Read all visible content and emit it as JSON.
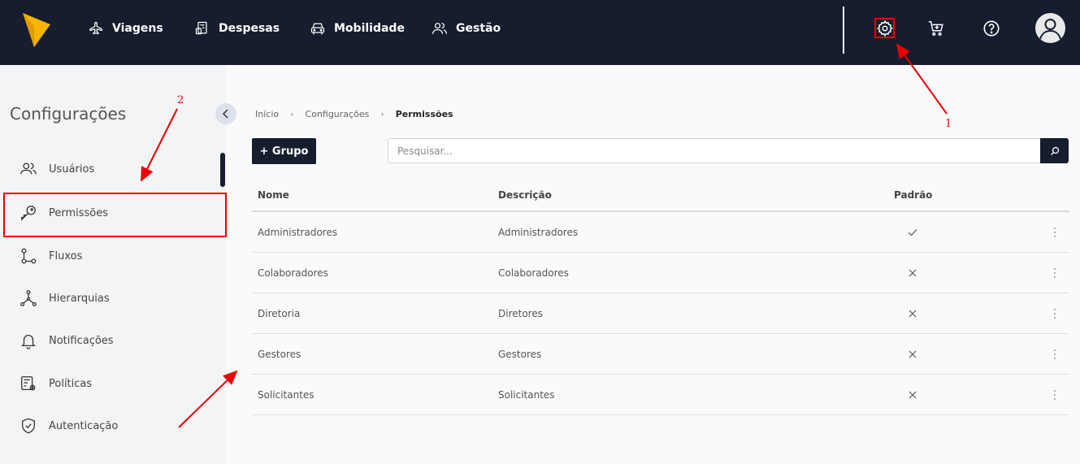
{
  "topbar": {
    "nav": [
      {
        "label": "Viagens",
        "icon": "airplane-icon"
      },
      {
        "label": "Despesas",
        "icon": "receipt-icon"
      },
      {
        "label": "Mobilidade",
        "icon": "car-icon"
      },
      {
        "label": "Gestão",
        "icon": "users-icon"
      }
    ],
    "icons": [
      "gear-icon",
      "cart-icon",
      "help-icon",
      "avatar"
    ]
  },
  "sidebar": {
    "title": "Configurações",
    "items": [
      {
        "label": "Usuários",
        "icon": "users-icon"
      },
      {
        "label": "Permissões",
        "icon": "key-icon"
      },
      {
        "label": "Fluxos",
        "icon": "flow-icon"
      },
      {
        "label": "Hierarquias",
        "icon": "hierarchy-icon"
      },
      {
        "label": "Notificações",
        "icon": "bell-icon"
      },
      {
        "label": "Políticas",
        "icon": "policy-icon"
      },
      {
        "label": "Autenticação",
        "icon": "shield-icon"
      }
    ]
  },
  "breadcrumb": [
    "Início",
    "Configurações",
    "Permissões"
  ],
  "toolbar": {
    "add_label": "+ Grupo",
    "search_placeholder": "Pesquisar..."
  },
  "table": {
    "headers": {
      "name": "Nome",
      "description": "Descrição",
      "default": "Padrão"
    },
    "rows": [
      {
        "name": "Administradores",
        "description": "Administradores",
        "default": true
      },
      {
        "name": "Colaboradores",
        "description": "Colaboradores",
        "default": false
      },
      {
        "name": "Diretoria",
        "description": "Diretores",
        "default": false
      },
      {
        "name": "Gestores",
        "description": "Gestores",
        "default": false
      },
      {
        "name": "Solicitantes",
        "description": "Solicitantes",
        "default": false
      }
    ]
  },
  "annotations": {
    "label_1": "1",
    "label_2": "2",
    "color": "#e00000"
  },
  "colors": {
    "navy": "#161d2f",
    "logo_yellow": "#f7b500"
  }
}
